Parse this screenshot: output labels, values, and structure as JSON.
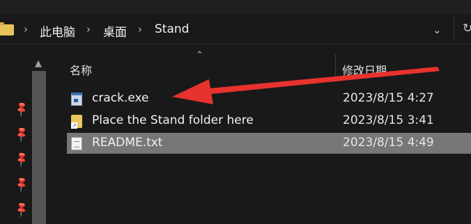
{
  "breadcrumb": {
    "items": [
      "此电脑",
      "桌面",
      "Stand"
    ],
    "separator": "›"
  },
  "icons": {
    "dropdown": "chevron-down-icon",
    "refresh": "refresh-icon",
    "pin": "pin-icon",
    "sort": "sort-ascending-icon"
  },
  "columns": {
    "name": "名称",
    "date": "修改日期"
  },
  "files": [
    {
      "name": "crack.exe",
      "date": "2023/8/15 4:27",
      "icon": "exe-file-icon"
    },
    {
      "name": "Place the Stand folder here",
      "date": "2023/8/15 3:41",
      "icon": "folder-shortcut-icon"
    },
    {
      "name": "README.txt",
      "date": "2023/8/15 4:49",
      "icon": "text-file-icon"
    }
  ],
  "selected_file": "README.txt",
  "annotation": {
    "type": "red arrow pointing to crack.exe",
    "color": "#e8322e"
  },
  "colors": {
    "background": "#191919",
    "selection": "#777777",
    "text": "#f2f2f2"
  }
}
